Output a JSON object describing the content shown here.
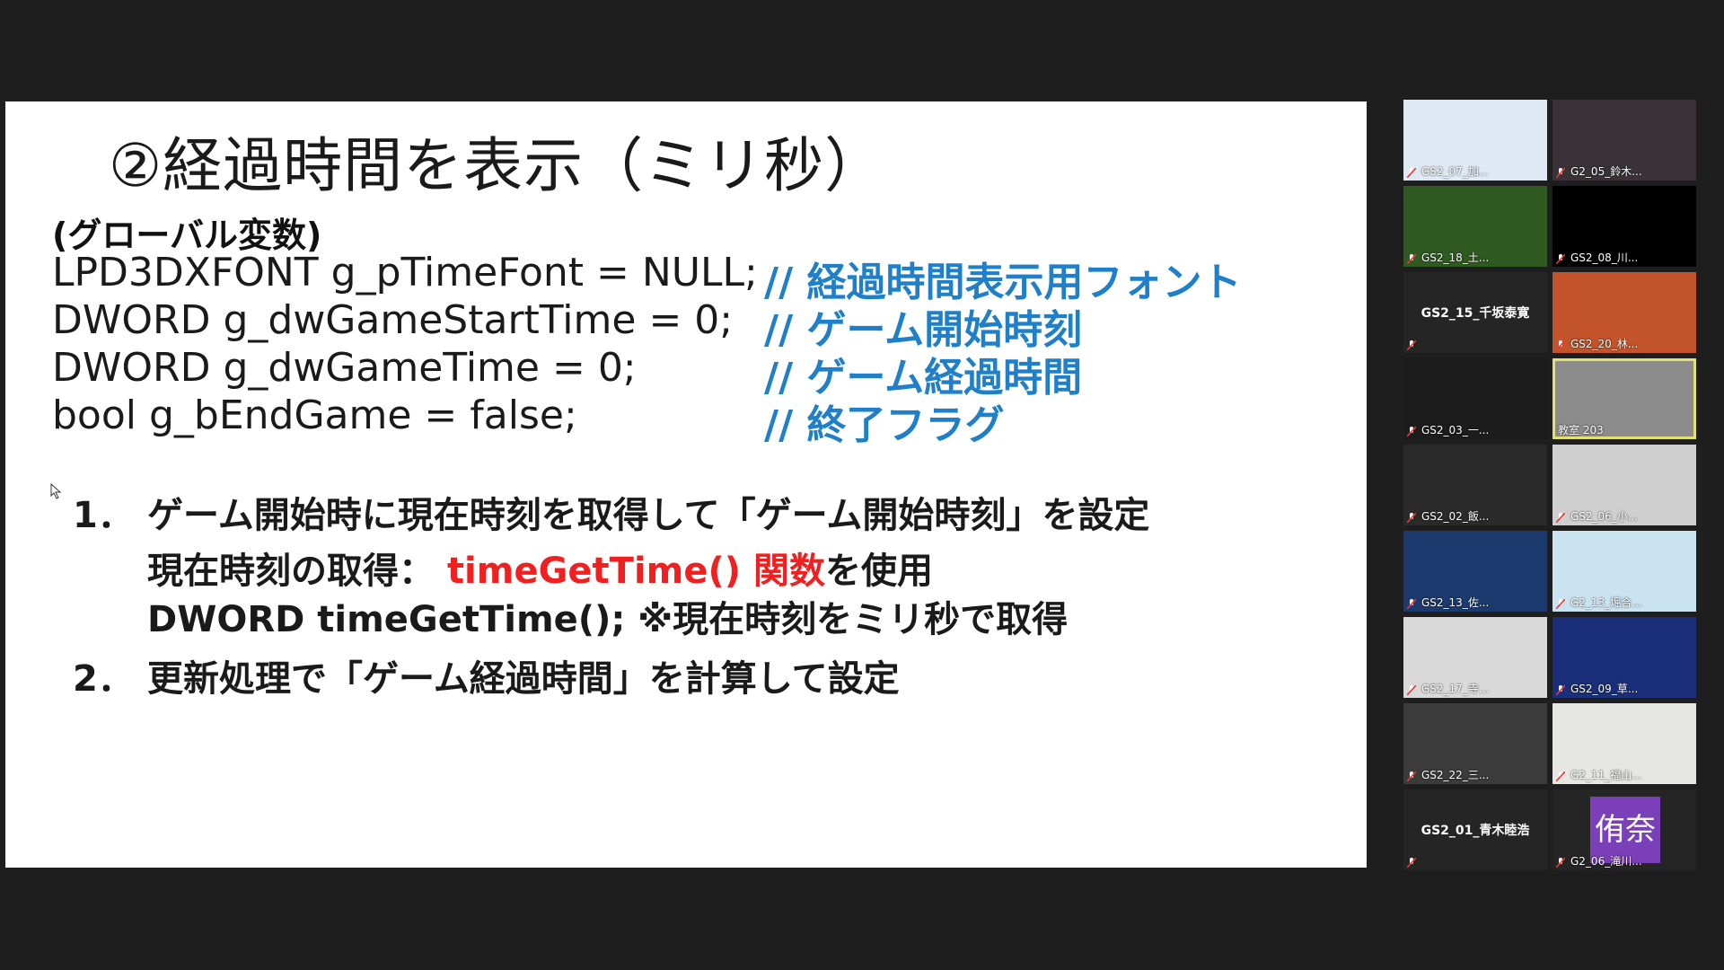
{
  "slide": {
    "title": "②経過時間を表示（ミリ秒）",
    "vars_header": "(グローバル変数)",
    "code": [
      {
        "code": "LPD3DXFONT g_pTimeFont = NULL;",
        "comment": "// 経過時間表示用フォント"
      },
      {
        "code": "DWORD g_dwGameStartTime = 0;",
        "comment": "// ゲーム開始時刻"
      },
      {
        "code": "DWORD g_dwGameTime = 0;",
        "comment": "// ゲーム経過時間"
      },
      {
        "code": "bool g_bEndGame = false;",
        "comment": "// 終了フラグ"
      }
    ],
    "step1": {
      "number": "1．",
      "text": "ゲーム開始時に現在時刻を取得して「ゲーム開始時刻」を設定",
      "sub1_prefix": "現在時刻の取得：",
      "sub1_highlight": "timeGetTime() 関数",
      "sub1_suffix": "を使用",
      "sub2": "DWORD timeGetTime();  ※現在時刻をミリ秒で取得"
    },
    "step2": {
      "number": "2．",
      "text": "更新処理で「ゲーム経過時間」を計算して設定"
    }
  },
  "participants": [
    {
      "label": "GS2_07_加...",
      "bg": "#dfe9f3"
    },
    {
      "label": "G2_05_鈴木...",
      "bg": "#3a3236"
    },
    {
      "label": "GS2_18_土...",
      "bg": "#2f5a22"
    },
    {
      "label": "GS2_08_川...",
      "bg": "#000000"
    },
    {
      "label": "GS2_15_千坂泰寛",
      "bg": "#252525",
      "name_only": true
    },
    {
      "label": "GS2_20_林...",
      "bg": "#c4542b"
    },
    {
      "label": "GS2_03_一...",
      "bg": "#1c1c1c"
    },
    {
      "label": "教室 203",
      "bg": "#8c8c8c",
      "active": true
    },
    {
      "label": "GS2_02_飯...",
      "bg": "#2a2a2a"
    },
    {
      "label": "GS2_06_小...",
      "bg": "#cfcfcf"
    },
    {
      "label": "GS2_13_佐...",
      "bg": "#1c3a6e"
    },
    {
      "label": "G2_13_堀合...",
      "bg": "#c9e3f1"
    },
    {
      "label": "GS2_17_寺...",
      "bg": "#d9d9d9"
    },
    {
      "label": "GS2_09_草...",
      "bg": "#1a2e7a"
    },
    {
      "label": "GS2_22_三...",
      "bg": "#3b3b3b"
    },
    {
      "label": "G2_11_福山...",
      "bg": "#e6e6e2"
    },
    {
      "label": "GS2_01_青木睦浩",
      "bg": "#252525",
      "name_only": true
    },
    {
      "label": "G2_06_滝川...",
      "bg": "#252525",
      "avatar": "侑奈"
    }
  ]
}
